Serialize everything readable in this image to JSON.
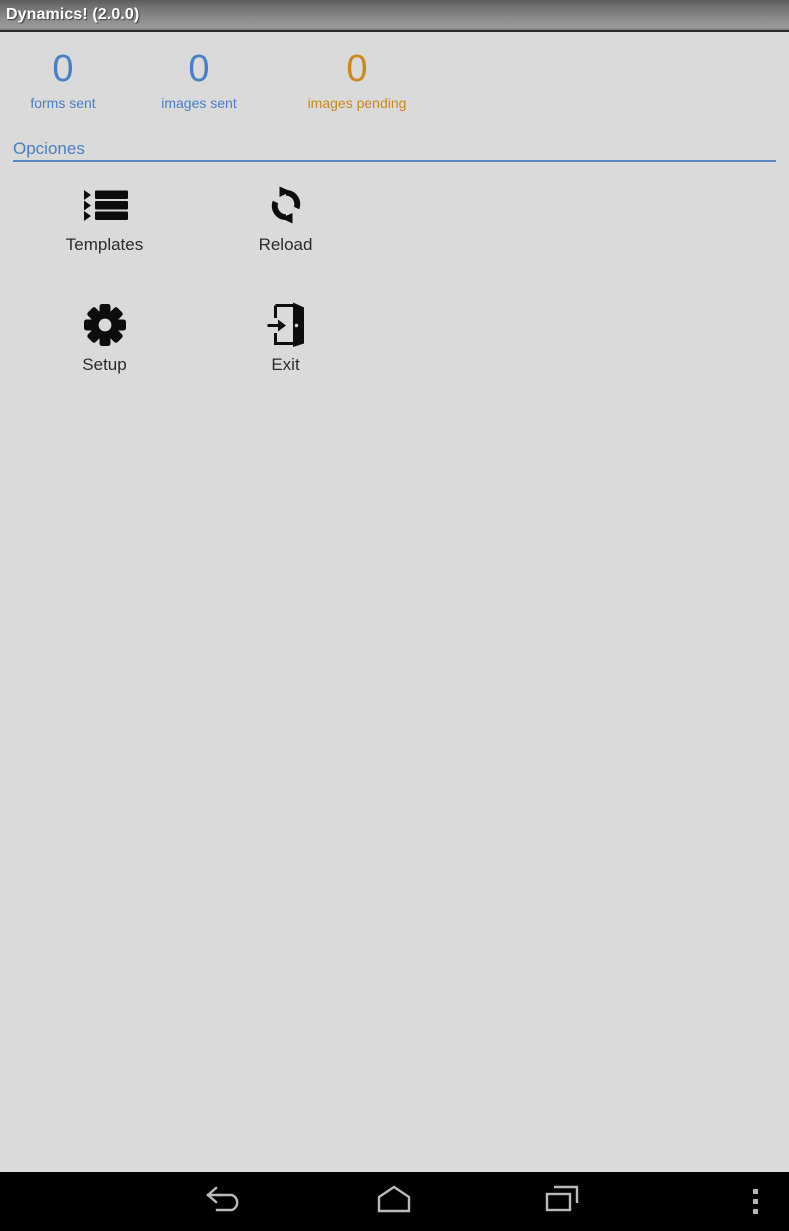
{
  "window": {
    "title": "Dynamics! (2.0.0)"
  },
  "colors": {
    "accent_blue": "#4a7fc1",
    "accent_amber": "#c8891e",
    "background": "#dadada",
    "titlebar_text": "#ffffff",
    "label_text": "#2b2b2b",
    "navbar_background": "#000000",
    "navbar_icon": "#b4b4b4"
  },
  "stats": {
    "items": [
      {
        "value": "0",
        "label": "forms sent",
        "color": "blue"
      },
      {
        "value": "0",
        "label": "images sent",
        "color": "blue"
      },
      {
        "value": "0",
        "label": "images pending",
        "color": "amber"
      }
    ]
  },
  "options": {
    "section_title": "Opciones",
    "items": [
      {
        "label": "Templates",
        "icon": "list-icon"
      },
      {
        "label": "Reload",
        "icon": "refresh-icon"
      },
      {
        "label": "Setup",
        "icon": "gear-icon"
      },
      {
        "label": "Exit",
        "icon": "exit-door-icon"
      }
    ]
  },
  "navbar": {
    "buttons": [
      {
        "name": "back",
        "icon": "back-arrow-icon"
      },
      {
        "name": "home",
        "icon": "home-icon"
      },
      {
        "name": "recents",
        "icon": "recents-icon"
      },
      {
        "name": "overflow",
        "icon": "overflow-menu-icon"
      }
    ]
  }
}
